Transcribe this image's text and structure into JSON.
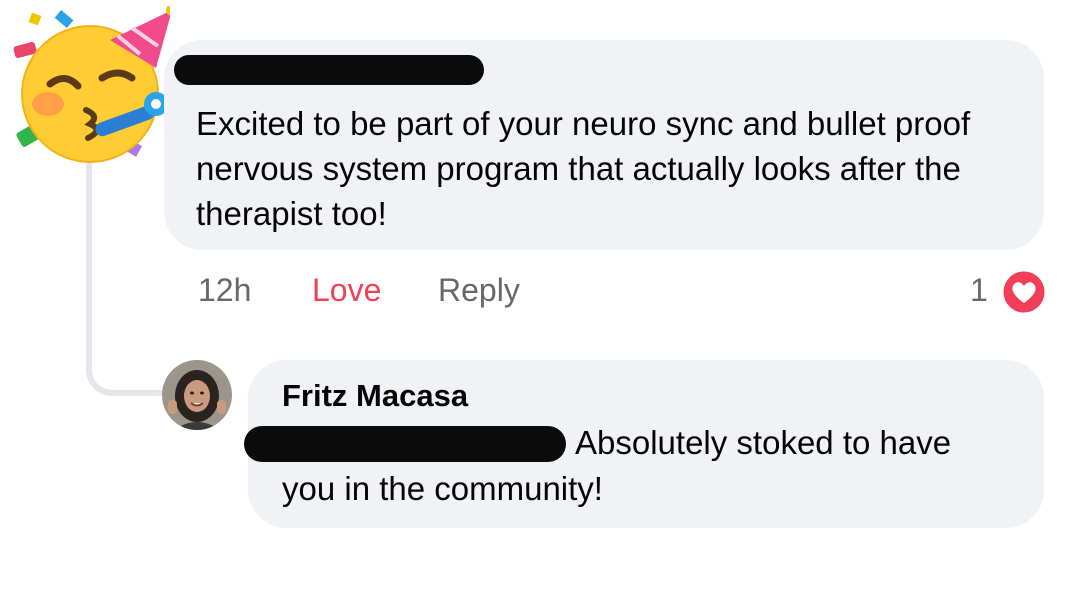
{
  "comment": {
    "avatar_icon": "partying-face-emoji-icon",
    "author_redacted": true,
    "text": "Excited to be part of your neuro sync and bullet proof nervous system program that actually looks after the therapist too!",
    "time": "12h",
    "love_label": "Love",
    "reply_label": "Reply",
    "reaction_count": "1",
    "reaction_icon": "heart-reaction-icon",
    "love_color": "#f33e58"
  },
  "reply": {
    "author": "Fritz Macasa",
    "mention_redacted": true,
    "text_line1": "Absolutely stoked to have",
    "text_line2": "you in the community!"
  },
  "colors": {
    "bubble": "#f0f2f5",
    "muted_text": "#65676b",
    "body_text": "#050505"
  }
}
